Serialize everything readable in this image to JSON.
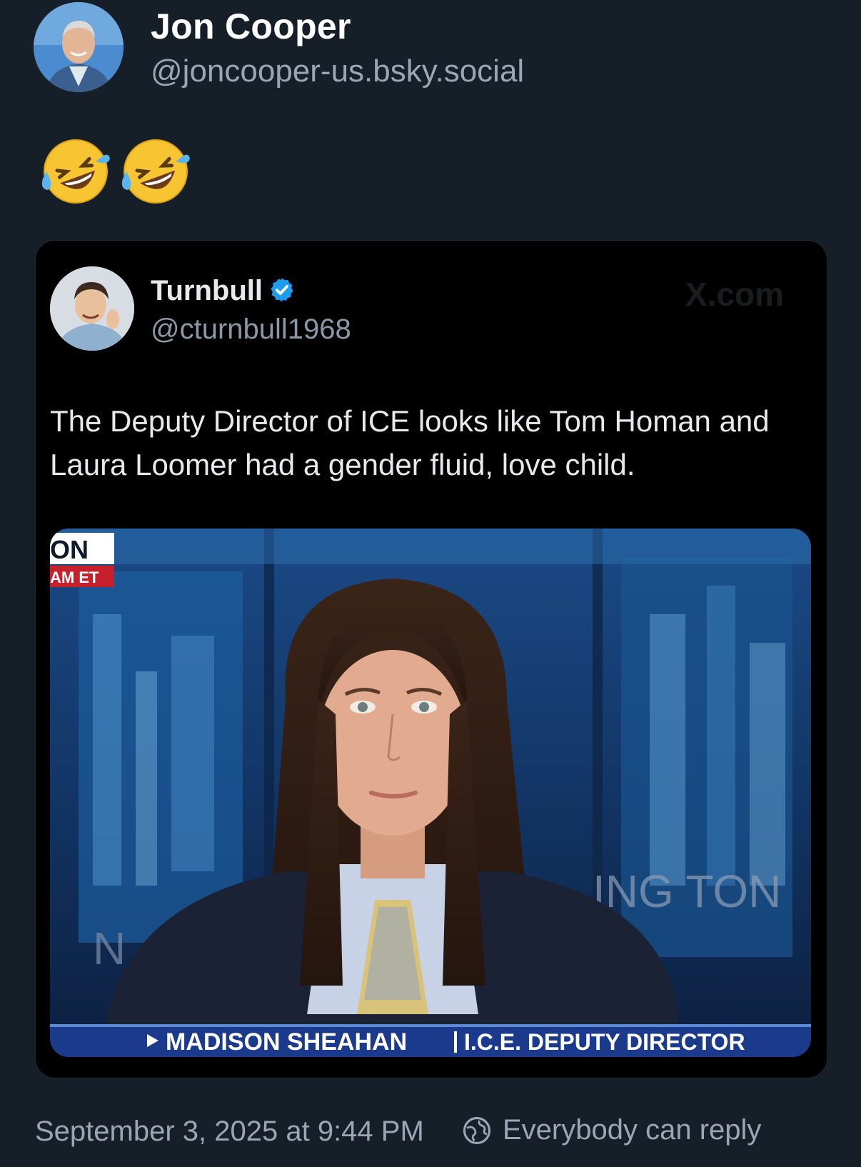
{
  "post": {
    "author_name": "Jon Cooper",
    "author_handle": "@joncooper-us.bsky.social",
    "emoji_count": 2,
    "emoji_name": "rolling-on-the-floor-laughing"
  },
  "quote": {
    "author_name": "Turnbull",
    "verified": true,
    "author_handle": "@cturnbull1968",
    "watermark": "X.com",
    "text": "The Deputy Director of ICE looks like Tom Homan and Laura Loomer had a gender fluid, love child.",
    "media": {
      "bug_top": "ON",
      "bug_bottom": "AM ET",
      "chyron_name": "MADISON SHEAHAN",
      "chyron_title": "I.C.E. DEPUTY DIRECTOR",
      "background_text_right": "ING TON",
      "background_text_left": "N"
    }
  },
  "footer": {
    "timestamp": "September 3, 2025 at 9:44 PM",
    "reply_setting": "Everybody can reply"
  },
  "colors": {
    "background": "#161e27",
    "card": "#000000",
    "verified": "#1d9bf0",
    "chyron": "#1c3a8c"
  }
}
